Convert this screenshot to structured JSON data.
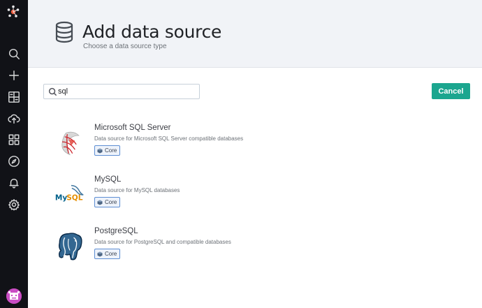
{
  "header": {
    "title": "Add data source",
    "subtitle": "Choose a data source type",
    "icon": "database-icon"
  },
  "search": {
    "value": "sql",
    "icon": "search-icon"
  },
  "actions": {
    "cancel_label": "Cancel"
  },
  "sidebar": {
    "items": [
      {
        "icon": "search-icon"
      },
      {
        "icon": "plus-icon"
      },
      {
        "icon": "dashboards-icon"
      },
      {
        "icon": "upload-icon"
      },
      {
        "icon": "apps-icon"
      },
      {
        "icon": "explore-icon"
      },
      {
        "icon": "bell-icon"
      },
      {
        "icon": "gear-icon"
      }
    ]
  },
  "datasources": [
    {
      "name": "Microsoft SQL Server",
      "description": "Data source for Microsoft SQL Server compatible databases",
      "badge": "Core",
      "logo": "mssql-logo"
    },
    {
      "name": "MySQL",
      "description": "Data source for MySQL databases",
      "badge": "Core",
      "logo": "mysql-logo"
    },
    {
      "name": "PostgreSQL",
      "description": "Data source for PostgreSQL and compatible databases",
      "badge": "Core",
      "logo": "postgresql-logo"
    }
  ],
  "colors": {
    "sidebar": "#111217",
    "header_bg": "#f1f3f7",
    "primary_button": "#1ba68f",
    "badge_border": "#5d8ed3"
  }
}
